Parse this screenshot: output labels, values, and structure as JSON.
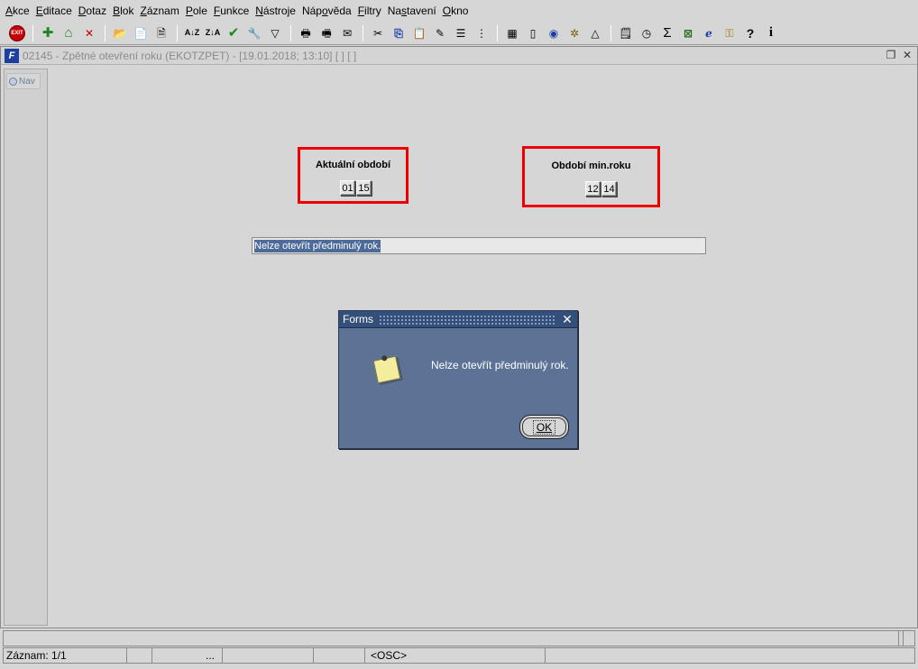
{
  "menu": [
    {
      "label": "Akce",
      "acc": "A",
      "rest": "kce"
    },
    {
      "label": "Editace",
      "acc": "E",
      "rest": "ditace"
    },
    {
      "label": "Dotaz",
      "acc": "D",
      "rest": "otaz"
    },
    {
      "label": "Blok",
      "acc": "B",
      "rest": "lok"
    },
    {
      "label": "Záznam",
      "acc": "Z",
      "rest": "áznam"
    },
    {
      "label": "Pole",
      "acc": "P",
      "rest": "ole"
    },
    {
      "label": "Funkce",
      "acc": "F",
      "rest": "unkce"
    },
    {
      "label": "Nástroje",
      "acc": "N",
      "rest": "ástroje"
    },
    {
      "label": "Nápověda",
      "pre": "Náp",
      "acc": "o",
      "rest": "věda"
    },
    {
      "label": "Filtry",
      "acc": "F",
      "rest": "iltry"
    },
    {
      "label": "Nastavení",
      "pre": "Na",
      "acc": "s",
      "rest": "tavení"
    },
    {
      "label": "Okno",
      "acc": "O",
      "rest": "kno"
    }
  ],
  "toolbar": {
    "exit_label": "EXIT",
    "sort_az": "A↓Z",
    "sort_za": "Z↓A",
    "sum": "Σ",
    "help": "?",
    "info": "i"
  },
  "window": {
    "title": "02145 - Zpětné otevření roku (EKOTZPET) - [19.01.2018; 13:10]  [ ]  [ ]",
    "app_icon": "F",
    "nav_label": "Nav"
  },
  "current_period": {
    "label": "Aktuální období",
    "month": "01",
    "year": "15"
  },
  "min_year_period": {
    "label": "Období min.roku",
    "month": "12",
    "year": "14"
  },
  "message_field": {
    "value": "Nelze otevřít předminulý rok."
  },
  "dialog": {
    "title": "Forms",
    "message": "Nelze otevřít předminulý rok.",
    "ok_label": "OK",
    "icon": "note-icon"
  },
  "statusbar": {
    "record": "Záznam: 1/1",
    "ellipsis": "...",
    "mode": "<OSC>"
  },
  "colors": {
    "highlight_frame": "#ee0000",
    "dialog_bg": "#5d7395",
    "dialog_title_bg": "#34507a"
  }
}
